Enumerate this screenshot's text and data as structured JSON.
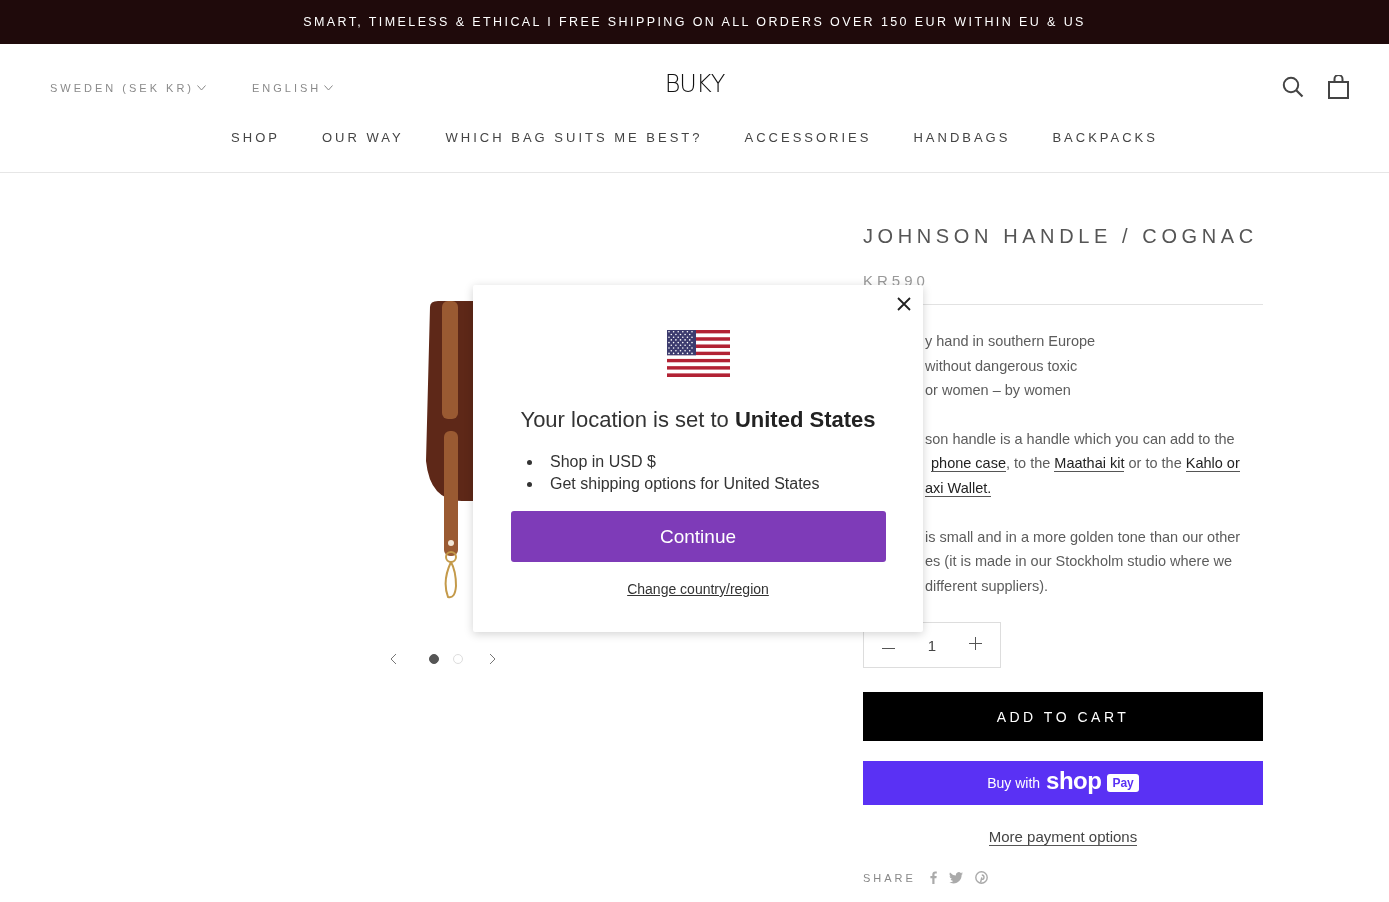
{
  "announcement": "SMART, TIMELESS & ETHICAL I FREE SHIPPING ON ALL ORDERS OVER 150 EUR WITHIN EU & US",
  "header": {
    "country_selector": "SWEDEN (SEK KR)",
    "language_selector": "ENGLISH",
    "logo": "BUKY",
    "nav": [
      "SHOP",
      "OUR WAY",
      "WHICH BAG SUITS ME BEST?",
      "ACCESSORIES",
      "HANDBAGS",
      "BACKPACKS"
    ]
  },
  "gallery": {
    "slides": [
      {
        "selected": true
      },
      {
        "selected": false
      }
    ]
  },
  "product": {
    "title": "JOHNSON HANDLE / COGNAC",
    "price": "KR590",
    "description": [
      {
        "lines": [
          [
            {
              "kind": "text",
              "text": "y hand in southern Europe"
            }
          ],
          [
            {
              "kind": "text",
              "text": "without dangerous toxic"
            }
          ],
          [
            {
              "kind": "text",
              "text": "or women – by women"
            }
          ]
        ]
      },
      {
        "lines": [
          [
            {
              "kind": "text",
              "text": "son handle is a handle which you can add to the"
            }
          ],
          [
            {
              "kind": "link",
              "text": "phone case"
            },
            {
              "kind": "text",
              "text": ", to the "
            },
            {
              "kind": "link",
              "text": "Maathai kit"
            },
            {
              "kind": "text",
              "text": " or to the "
            },
            {
              "kind": "link",
              "text": "Kahlo or"
            }
          ],
          [
            {
              "kind": "link",
              "text": "axi Wallet."
            }
          ]
        ]
      },
      {
        "lines": [
          [
            {
              "kind": "text",
              "text": "is small and in a more golden tone than our other"
            }
          ],
          [
            {
              "kind": "text",
              "text": "es (it is made in our Stockholm studio where we"
            }
          ],
          [
            {
              "kind": "text",
              "text": "different suppliers)."
            }
          ]
        ]
      }
    ],
    "quantity": "1",
    "add_to_cart": "ADD TO CART",
    "shop_pay": {
      "prefix": "Buy with",
      "brand": "shop",
      "badge": "Pay"
    },
    "more_payment": "More payment options",
    "share_label": "SHARE"
  },
  "location_popup": {
    "heading": "Your location is set to **United States**",
    "bullets": [
      "Shop in USD $",
      "Get shipping options for United States"
    ],
    "continue": "Continue",
    "change_link": "Change country/region"
  }
}
